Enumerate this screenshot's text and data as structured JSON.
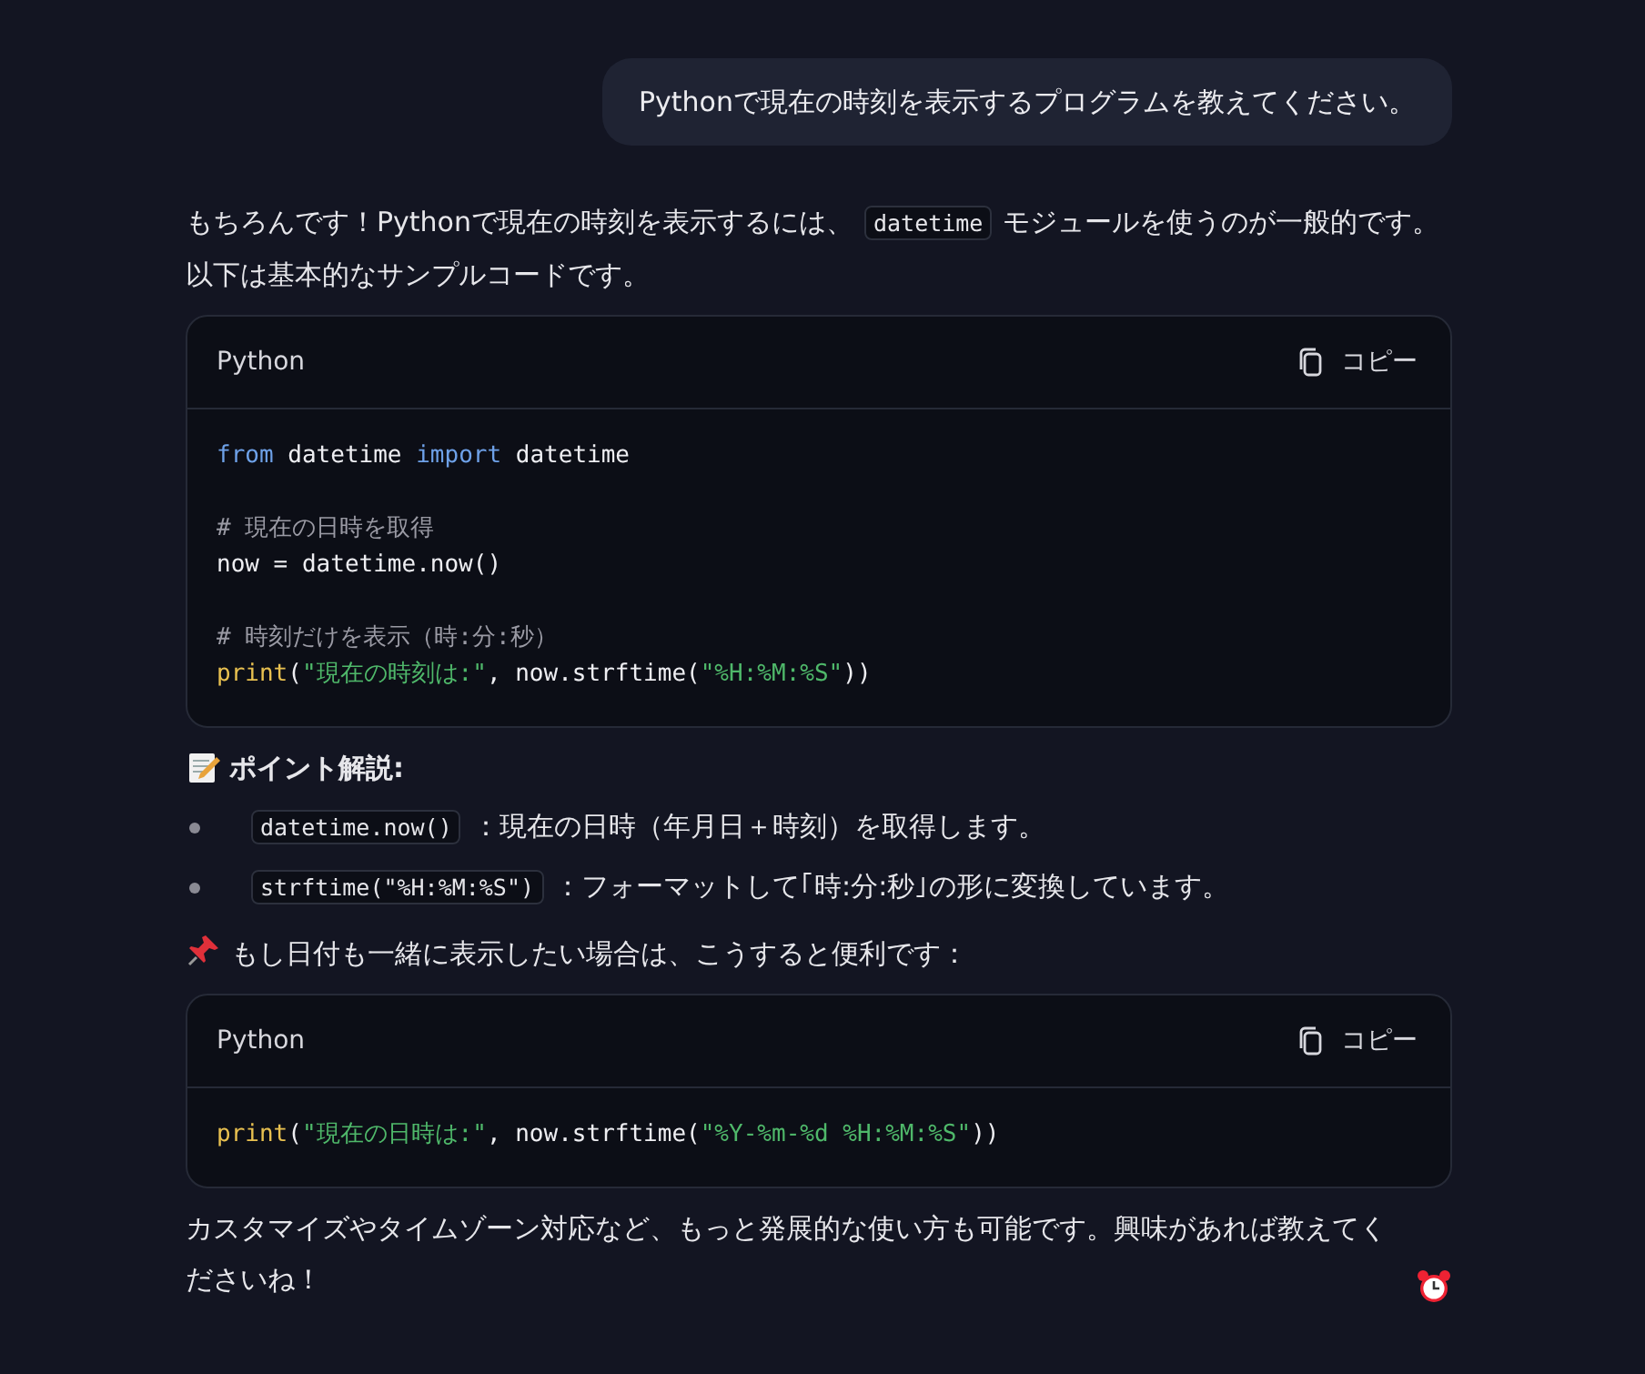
{
  "user_message": "Pythonで現在の時刻を表示するプログラムを教えてください。",
  "reply": [
    {
      "kind": "paragraph",
      "segments": [
        {
          "kind": "text",
          "text": "もちろんです！Pythonで現在の時刻を表示するには、"
        },
        {
          "kind": "code",
          "text": "datetime"
        },
        {
          "kind": "text",
          "text": "モジュールを使うのが一般的です。以下は基本的なサンプルコードです。"
        }
      ]
    },
    {
      "kind": "code_block",
      "language": "Python",
      "copy_label": "コピー",
      "lines": [
        {
          "kind": "code",
          "tokens": [
            {
              "kind": "keyword",
              "text": "from"
            },
            {
              "kind": "plain",
              "text": " datetime "
            },
            {
              "kind": "keyword",
              "text": "import"
            },
            {
              "kind": "plain",
              "text": " datetime"
            }
          ]
        },
        {
          "kind": "blank"
        },
        {
          "kind": "code",
          "tokens": [
            {
              "kind": "comment",
              "text": "# 現在の日時を取得"
            }
          ]
        },
        {
          "kind": "code",
          "tokens": [
            {
              "kind": "plain",
              "text": "now = datetime.now()"
            }
          ]
        },
        {
          "kind": "blank"
        },
        {
          "kind": "code",
          "tokens": [
            {
              "kind": "comment",
              "text": "# 時刻だけを表示（時:分:秒）"
            }
          ]
        },
        {
          "kind": "code",
          "tokens": [
            {
              "kind": "func",
              "text": "print"
            },
            {
              "kind": "plain",
              "text": "("
            },
            {
              "kind": "string",
              "text": "\"現在の時刻は:\""
            },
            {
              "kind": "plain",
              "text": ", now.strftime("
            },
            {
              "kind": "string",
              "text": "\"%H:%M:%S\""
            },
            {
              "kind": "plain",
              "text": "))"
            }
          ]
        }
      ]
    },
    {
      "kind": "note_heading",
      "segments": [
        {
          "kind": "text",
          "text": "ポイント解説:"
        }
      ]
    },
    {
      "kind": "bullets",
      "items": [
        {
          "segments": [
            {
              "kind": "code",
              "text": "datetime.now()"
            },
            {
              "kind": "text",
              "text": "：現在の日時（年月日＋時刻）を取得します。"
            }
          ]
        },
        {
          "segments": [
            {
              "kind": "code",
              "text": "strftime(\"%H:%M:%S\")"
            },
            {
              "kind": "text",
              "text": "：フォーマットして｢時:分:秒｣の形に変換しています。"
            }
          ]
        }
      ]
    },
    {
      "kind": "tip_paragraph",
      "segments": [
        {
          "kind": "text",
          "text": "もし日付も一緒に表示したい場合は、こうすると便利です："
        }
      ]
    },
    {
      "kind": "code_block",
      "language": "Python",
      "copy_label": "コピー",
      "lines": [
        {
          "kind": "code",
          "tokens": [
            {
              "kind": "func",
              "text": "print"
            },
            {
              "kind": "plain",
              "text": "("
            },
            {
              "kind": "string",
              "text": "\"現在の日時は:\""
            },
            {
              "kind": "plain",
              "text": ", now.strftime("
            },
            {
              "kind": "string",
              "text": "\"%Y-%m-%d %H:%M:%S\""
            },
            {
              "kind": "plain",
              "text": "))"
            }
          ]
        }
      ]
    },
    {
      "kind": "closing_paragraph",
      "segments": [
        {
          "kind": "text",
          "text": "カスタマイズやタイムゾーン対応など、もっと発展的な使い方も可能です。興味があれば教えてくださいね！"
        }
      ]
    }
  ]
}
